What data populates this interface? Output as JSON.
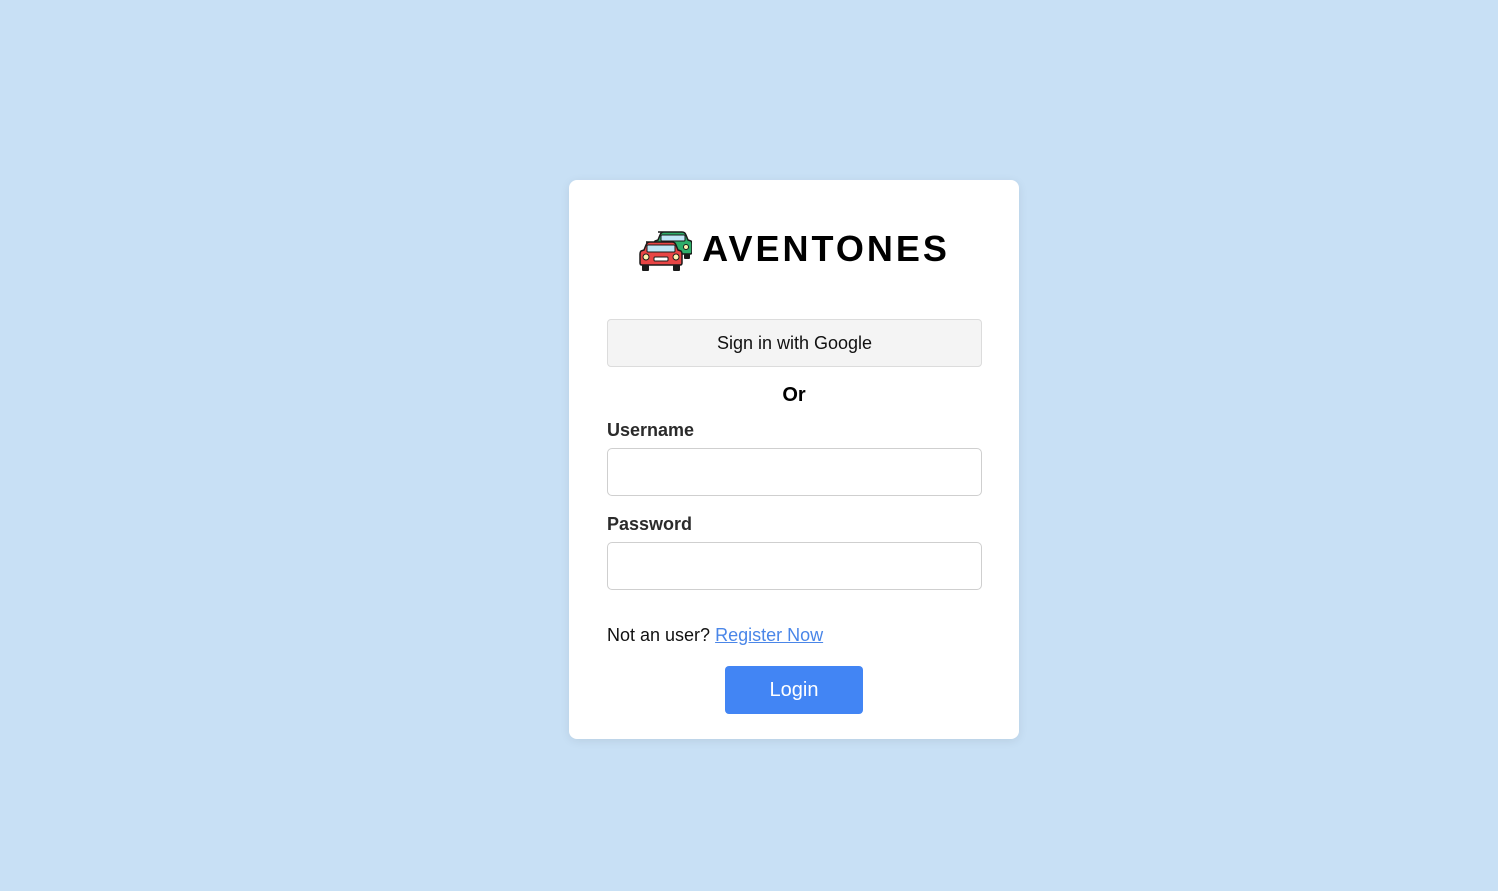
{
  "brand": {
    "name": "AVENTONES",
    "logo_icon": "cars-icon"
  },
  "auth": {
    "google_button_label": "Sign in with Google",
    "divider_text": "Or",
    "username_label": "Username",
    "username_value": "",
    "password_label": "Password",
    "password_value": "",
    "register_prompt": "Not an user?",
    "register_link": "Register Now",
    "login_button_label": "Login"
  },
  "colors": {
    "background": "#c8e0f5",
    "card": "#ffffff",
    "primary": "#4285f4",
    "link": "#4a86e8"
  }
}
